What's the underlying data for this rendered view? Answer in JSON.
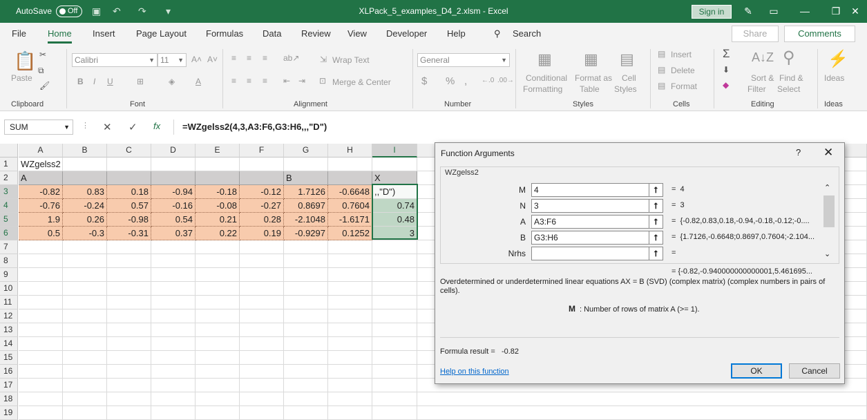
{
  "titlebar": {
    "autosave_label": "AutoSave",
    "autosave_state": "Off",
    "title": "XLPack_5_examples_D4_2.xlsm  -  Excel",
    "signin": "Sign in"
  },
  "menu": {
    "tabs": [
      "File",
      "Home",
      "Insert",
      "Page Layout",
      "Formulas",
      "Data",
      "Review",
      "View",
      "Developer",
      "Help"
    ],
    "search": "Search",
    "share": "Share",
    "comments": "Comments"
  },
  "ribbon": {
    "paste": "Paste",
    "font_name": "Calibri",
    "font_size": "11",
    "wrap_text": "Wrap Text",
    "merge_center": "Merge & Center",
    "number_format": "General",
    "conditional_formatting": [
      "Conditional",
      "Formatting"
    ],
    "format_as_table": [
      "Format as",
      "Table"
    ],
    "cell_styles": [
      "Cell",
      "Styles"
    ],
    "insert": "Insert",
    "delete": "Delete",
    "format": "Format",
    "sort_filter": [
      "Sort &",
      "Filter"
    ],
    "find_select": [
      "Find &",
      "Select"
    ],
    "ideas": "Ideas",
    "groups": [
      "Clipboard",
      "Font",
      "Alignment",
      "Number",
      "Styles",
      "Cells",
      "Editing",
      "Ideas"
    ]
  },
  "formula_bar": {
    "name_box": "SUM",
    "formula": "=WZgelss2(4,3,A3:F6,G3:H6,,,\"D\")"
  },
  "sheet": {
    "columns": [
      "A",
      "B",
      "C",
      "D",
      "E",
      "F",
      "G",
      "H",
      "I"
    ],
    "rows": [
      "1",
      "2",
      "3",
      "4",
      "5",
      "6",
      "7",
      "8",
      "9",
      "10",
      "11",
      "12",
      "13",
      "14",
      "15",
      "16",
      "17",
      "18",
      "19"
    ],
    "a1": "WZgelss2",
    "a2": "A",
    "g2": "B",
    "i2": "X",
    "matrix_a": [
      [
        "-0.82",
        "0.83",
        "0.18",
        "-0.94",
        "-0.18",
        "-0.12"
      ],
      [
        "-0.76",
        "-0.24",
        "0.57",
        "-0.16",
        "-0.08",
        "-0.27"
      ],
      [
        "1.9",
        "0.26",
        "-0.98",
        "0.54",
        "0.21",
        "0.28"
      ],
      [
        "0.5",
        "-0.3",
        "-0.31",
        "0.37",
        "0.22",
        "0.19"
      ]
    ],
    "matrix_b": [
      [
        "1.7126",
        "-0.6648"
      ],
      [
        "0.8697",
        "0.7604"
      ],
      [
        "-2.1048",
        "-1.6171"
      ],
      [
        "-0.9297",
        "0.1252"
      ]
    ],
    "x_col": [
      ",,\"D\")",
      "0.74",
      "0.48",
      "3"
    ]
  },
  "dialog": {
    "title": "Function Arguments",
    "help_glyph": "?",
    "function_name": "WZgelss2",
    "args": [
      {
        "label": "M",
        "value": "4",
        "result": "4"
      },
      {
        "label": "N",
        "value": "3",
        "result": "3"
      },
      {
        "label": "A",
        "value": "A3:F6",
        "result": "{-0.82,0.83,0.18,-0.94,-0.18,-0.12;-0...."
      },
      {
        "label": "B",
        "value": "G3:H6",
        "result": "{1.7126,-0.6648;0.8697,0.7604;-2.104..."
      },
      {
        "label": "Nrhs",
        "value": "",
        "result": ""
      }
    ],
    "overall_result": "=  {-0.82,-0.940000000000001,5.461695...",
    "description": "Overdetermined or underdetermined linear equations AX = B (SVD) (complex matrix) (complex numbers in pairs of cells).",
    "arg_name": "M",
    "arg_description": ": Number of rows of matrix A (>= 1).",
    "formula_result_label": "Formula result =",
    "formula_result": "-0.82",
    "help_link": "Help on this function",
    "ok": "OK",
    "cancel": "Cancel"
  },
  "colors": {
    "excel_green": "#217346",
    "data_fill": "#f8cbad",
    "header_fill": "#d0cece",
    "selection_fill": "#bfd7c5"
  }
}
